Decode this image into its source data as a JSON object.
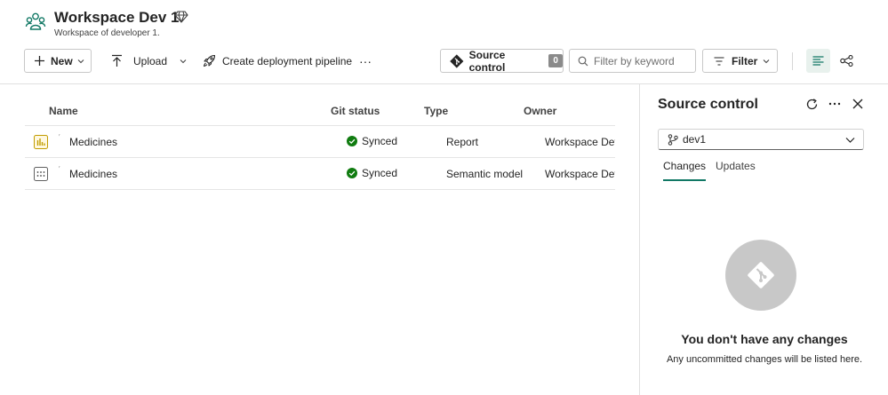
{
  "workspace": {
    "title": "Workspace Dev 1",
    "subtitle": "Workspace of developer 1.",
    "icon": "workspace-people-icon",
    "badge_icon": "diamond-icon"
  },
  "toolbar": {
    "new_label": "New",
    "upload_label": "Upload",
    "pipeline_label": "Create deployment pipeline",
    "more_label": "···",
    "source_control_label": "Source control",
    "source_control_count": "0",
    "filter_placeholder": "Filter by keyword",
    "filter_label": "Filter"
  },
  "table": {
    "columns": [
      "Name",
      "Git status",
      "Type",
      "Owner"
    ],
    "rows": [
      {
        "name": "Medicines",
        "git_status": "Synced",
        "type": "Report",
        "owner": "Workspace Dev",
        "icon": "report-icon"
      },
      {
        "name": "Medicines",
        "git_status": "Synced",
        "type": "Semantic model",
        "owner": "Workspace Dev",
        "icon": "semantic-model-icon"
      }
    ]
  },
  "panel": {
    "title": "Source control",
    "branch": "dev1",
    "tabs": [
      "Changes",
      "Updates"
    ],
    "active_tab": "Changes",
    "empty_title": "You don't have any changes",
    "empty_subtitle": "Any uncommitted changes will be listed here."
  },
  "colors": {
    "accent": "#117865",
    "synced": "#107c10",
    "report": "#c19c00",
    "empty_circle": "#c8c8c8"
  }
}
